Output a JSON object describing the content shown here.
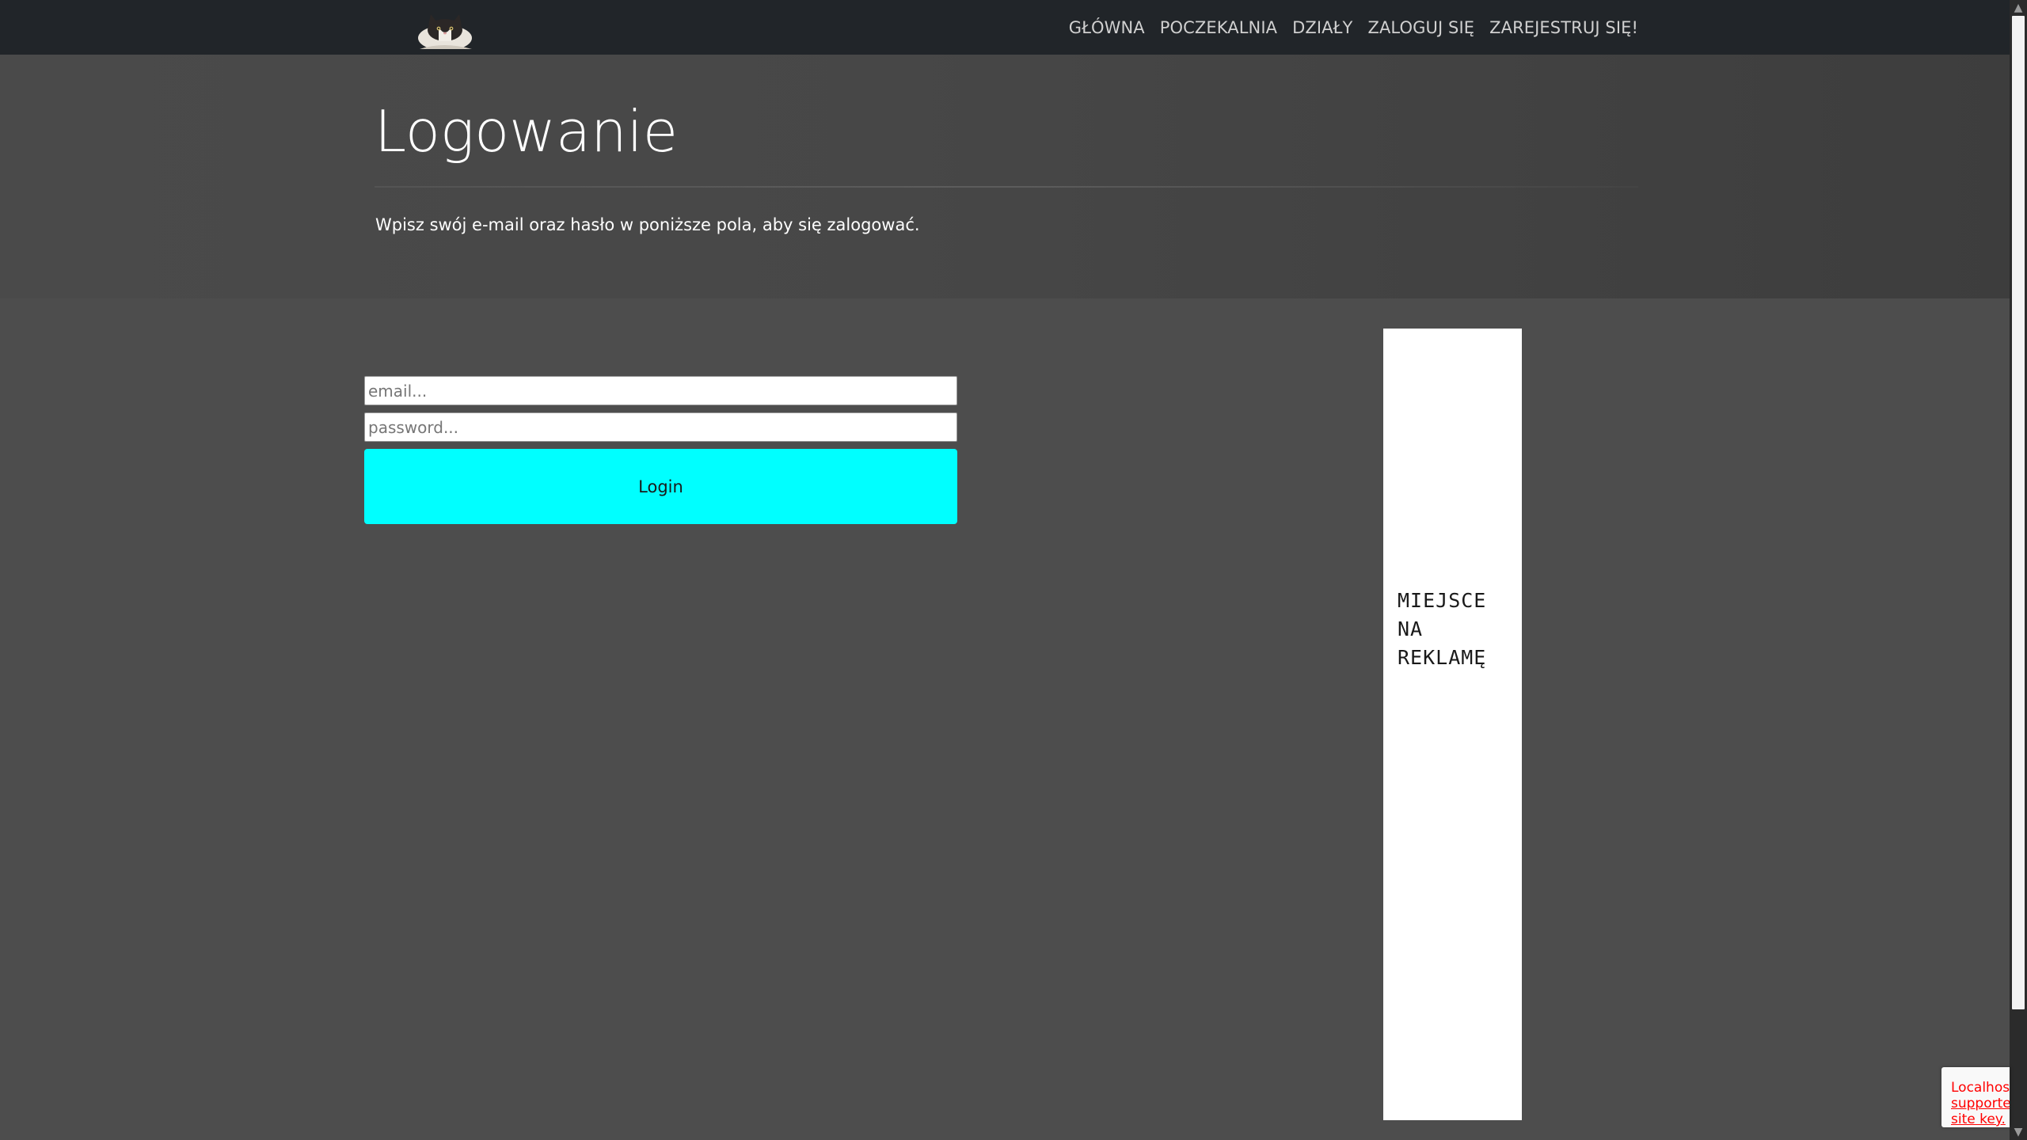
{
  "navbar": {
    "brand_logo": "cat-logo",
    "links": [
      {
        "label": "GŁÓWNA"
      },
      {
        "label": "POCZEKALNIA"
      },
      {
        "label": "DZIAŁY"
      },
      {
        "label": "ZALOGUJ SIĘ"
      },
      {
        "label": "ZAREJESTRUJ SIĘ!"
      }
    ]
  },
  "hero": {
    "title": "Logowanie",
    "lead": "Wpisz swój e-mail oraz hasło w poniższe pola, aby się zalogować."
  },
  "login_form": {
    "email_placeholder": "email...",
    "password_placeholder": "password...",
    "submit_label": "Login"
  },
  "ad": {
    "text": "MIEJSCE\nNA\nREKLAMĘ"
  },
  "captcha_badge": {
    "line1": "Localhost",
    "line2": "supported",
    "line3": "site key."
  },
  "colors": {
    "navbar_bg": "#212529",
    "page_bg": "#4d4d4d",
    "button_accent": "#00ffff",
    "captcha_error": "#ff0000"
  }
}
